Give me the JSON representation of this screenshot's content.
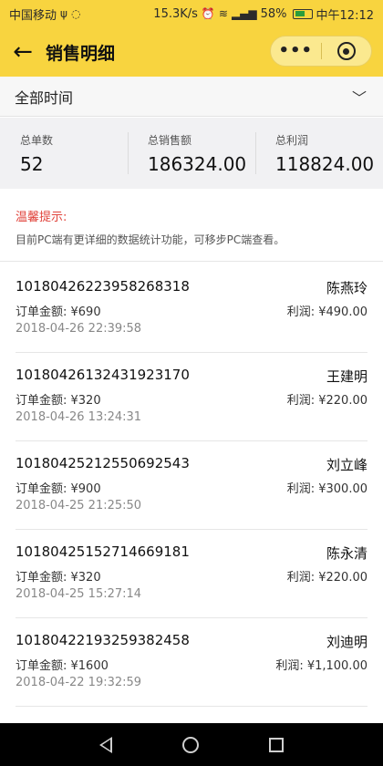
{
  "status_bar": {
    "carrier": "中国移动",
    "speed": "15.3K/s",
    "battery": "58%",
    "time": "中午12:12"
  },
  "nav": {
    "title": "销售明细",
    "more": "•••"
  },
  "filter": {
    "label": "全部时间"
  },
  "stats": {
    "order_count": {
      "label": "总单数",
      "value": "52"
    },
    "total_sales": {
      "label": "总销售额",
      "value": "186324.00"
    },
    "total_profit": {
      "label": "总利润",
      "value": "118824.00"
    }
  },
  "tip": {
    "title": "温馨提示:",
    "text": "目前PC端有更详细的数据统计功能，可移步PC端查看。"
  },
  "orders": [
    {
      "no": "10180426223958268318",
      "name": "陈燕玲",
      "amount": "订单金额: ¥690",
      "profit": "利润: ¥490.00",
      "time": "2018-04-26 22:39:58"
    },
    {
      "no": "10180426132431923170",
      "name": "王建明",
      "amount": "订单金额: ¥320",
      "profit": "利润: ¥220.00",
      "time": "2018-04-26 13:24:31"
    },
    {
      "no": "10180425212550692543",
      "name": "刘立峰",
      "amount": "订单金额: ¥900",
      "profit": "利润: ¥300.00",
      "time": "2018-04-25 21:25:50"
    },
    {
      "no": "10180425152714669181",
      "name": "陈永清",
      "amount": "订单金额: ¥320",
      "profit": "利润: ¥220.00",
      "time": "2018-04-25 15:27:14"
    },
    {
      "no": "10180422193259382458",
      "name": "刘迪明",
      "amount": "订单金额: ¥1600",
      "profit": "利润: ¥1,100.00",
      "time": "2018-04-22 19:32:59"
    }
  ]
}
